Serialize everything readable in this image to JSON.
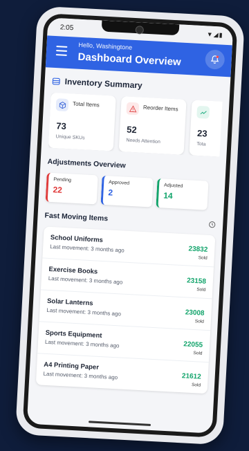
{
  "status": {
    "time": "2:05",
    "icons_text": "▼◢▮"
  },
  "header": {
    "greeting": "Hello, Washingtone",
    "title": "Dashboard Overview"
  },
  "inventory": {
    "title": "Inventory Summary",
    "cards": [
      {
        "label": "Total Items",
        "value": "73",
        "sub": "Unique SKUs",
        "accent": "#3b66d8",
        "icon": "box-icon"
      },
      {
        "label": "Reorder Items",
        "value": "52",
        "sub": "Needs Attention",
        "accent": "#e04848",
        "icon": "warning-icon"
      },
      {
        "label": "",
        "value": "23",
        "sub": "Tota",
        "accent": "#14a87a",
        "icon": "trend-icon"
      }
    ]
  },
  "adjustments": {
    "title": "Adjustments Overview",
    "cards": [
      {
        "label": "Pending",
        "value": "22",
        "color": "#e03b3b"
      },
      {
        "label": "Approved",
        "value": "2",
        "color": "#2f63e3"
      },
      {
        "label": "Adjusted",
        "value": "14",
        "color": "#12a46b"
      }
    ]
  },
  "fast_moving": {
    "title": "Fast Moving Items",
    "items": [
      {
        "name": "School Uniforms",
        "sub": "Last movement: 3 months ago",
        "value": "23832",
        "unit": "Sold"
      },
      {
        "name": "Exercise Books",
        "sub": "Last movement: 3 months ago",
        "value": "23158",
        "unit": "Sold"
      },
      {
        "name": "Solar Lanterns",
        "sub": "Last movement: 3 months ago",
        "value": "23008",
        "unit": "Sold"
      },
      {
        "name": "Sports Equipment",
        "sub": "Last movement: 3 months ago",
        "value": "22055",
        "unit": "Sold"
      },
      {
        "name": "A4 Printing Paper",
        "sub": "Last movement: 3 months ago",
        "value": "21612",
        "unit": "Sold"
      }
    ]
  }
}
